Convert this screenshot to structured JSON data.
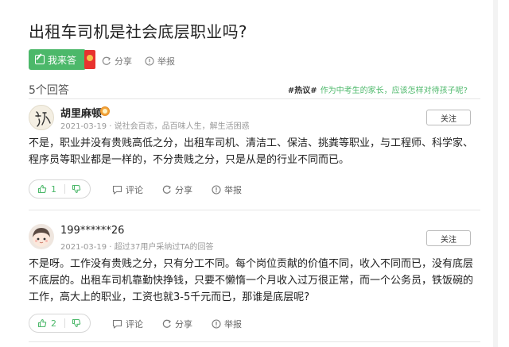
{
  "question": {
    "title": "出租车司机是社会底层职业吗?"
  },
  "actions": {
    "answer_label": "我来答",
    "share_label": "分享",
    "report_label": "举报"
  },
  "answers_count": "5个回答",
  "hot_topic": {
    "tag": "#热议#",
    "text": "作为中考生的家长，应该怎样对待孩子呢?"
  },
  "answers": [
    {
      "user": "胡里麻顿",
      "meta": "2021-03-19 · 说社会百态，品百味人生，解生活困惑",
      "follow_label": "关注",
      "content": "不是，职业并没有贵贱高低之分，出租车司机、清洁工、保洁、挑粪等职业，与工程师、科学家、程序员等职业都是一样的，不分贵贱之分，只是从是的行业不同而已。",
      "likes": "1",
      "comment_label": "评论",
      "share_label": "分享",
      "report_label": "举报"
    },
    {
      "user": "199******26",
      "meta": "2021-03-19 · 超过37用户采纳过TA的回答",
      "follow_label": "关注",
      "content": "不是呀。工作没有贵贱之分，只有分工不同。每个岗位贡献的价值不同，收入不同而已，没有底层不底层的。出租车司机靠勤快挣钱，只要不懒惰一个月收入过万很正常，而一个公务员，铁饭碗的工作，高大上的职业，工资也就3-5千元而已，那谁是底层呢?",
      "likes": "2",
      "comment_label": "评论",
      "share_label": "分享",
      "report_label": "举报"
    }
  ],
  "colors": {
    "accent": "#4cb86a",
    "redpack": "#e8322e"
  }
}
